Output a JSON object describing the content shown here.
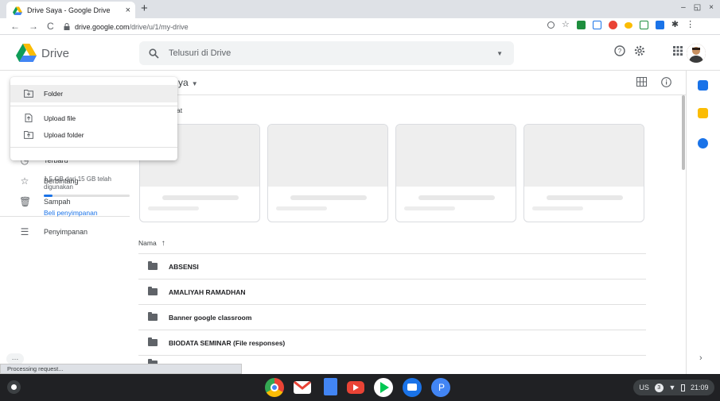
{
  "browser": {
    "tab_title": "Drive Saya - Google Drive",
    "tab_close": "×",
    "new_tab": "+",
    "window_min": "–",
    "window_restore": "◱",
    "window_close": "×",
    "url_host": "drive.google.com",
    "url_path": "/drive/u/1/my-drive",
    "back": "←",
    "forward": "→",
    "reload": "C",
    "status_text": "Processing request..."
  },
  "header": {
    "brand": "Drive",
    "search_placeholder": "Telusuri di Drive"
  },
  "new_menu": {
    "items": [
      {
        "label": "Folder",
        "icon": "new-folder-icon"
      },
      {
        "label": "Upload file",
        "icon": "file-upload-icon"
      },
      {
        "label": "Upload folder",
        "icon": "folder-upload-icon"
      }
    ]
  },
  "leftnav": {
    "partial_item": "Terbaru",
    "items": [
      {
        "label": "Berbintang",
        "icon": "star-icon"
      },
      {
        "label": "Sampah",
        "icon": "trash-icon"
      },
      {
        "label": "Penyimpanan",
        "icon": "storage-icon"
      }
    ],
    "storage_text": "1,5 GB dari 15 GB telah digunakan",
    "storage_used_fraction": 0.1,
    "buy_storage": "Beli penyimpanan"
  },
  "main": {
    "breadcrumb": "ya",
    "quick_access_label": "at",
    "sort_label": "Nama",
    "sort_arrow": "↑",
    "folders": [
      "ABSENSI",
      "AMALIYAH RAMADHAN",
      "Banner google classroom",
      "BIODATA SEMINAR (File responses)"
    ]
  },
  "shelf": {
    "tray_locale": "US",
    "tray_badge": "3",
    "clock": "21:09"
  },
  "colors": {
    "accent": "#1a73e8",
    "shelf": "#202124"
  }
}
